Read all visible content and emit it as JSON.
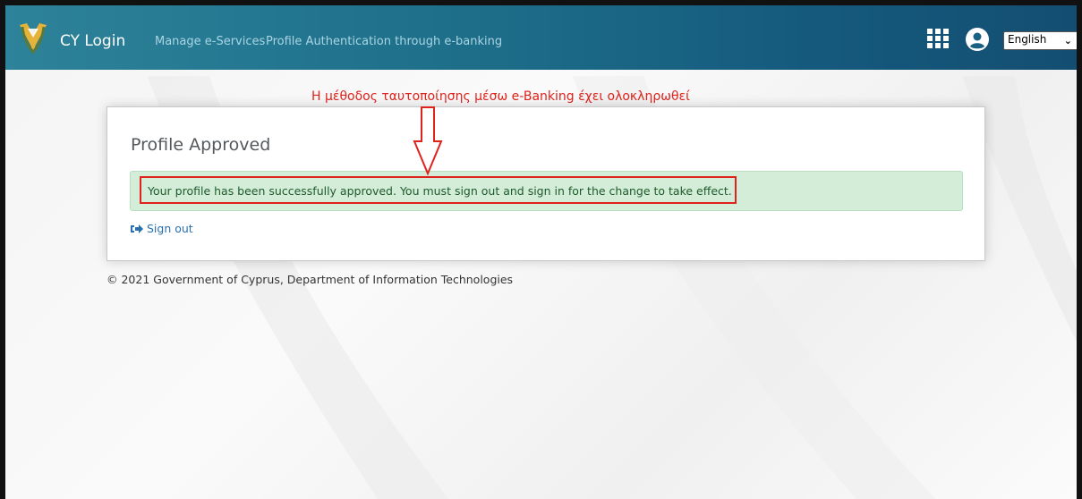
{
  "navbar": {
    "brand": "CY Login",
    "links": [
      "Manage e-Services",
      "Profile Authentication through e-banking"
    ],
    "language": "English",
    "icons": [
      "cyprus-emblem-icon",
      "apps-grid-icon",
      "user-account-icon",
      "chevron-down-icon"
    ]
  },
  "annotation": {
    "text": "Η μέθοδος ταυτοποίησης μέσω e-Banking έχει ολοκληρωθεί",
    "color": "#e0221c"
  },
  "card": {
    "title": "Profile Approved",
    "alert_text": "Your profile has been successfully approved. You must sign out and sign in for the change to take effect.",
    "signout_label": "Sign out"
  },
  "footer": {
    "text": "© 2021 Government of Cyprus, Department of Information Technologies"
  },
  "colors": {
    "navbar_start": "#2d8399",
    "navbar_end": "#134e72",
    "alert_bg": "#d4edd9",
    "link": "#2a6fb0",
    "annotation_red": "#e0221c"
  }
}
